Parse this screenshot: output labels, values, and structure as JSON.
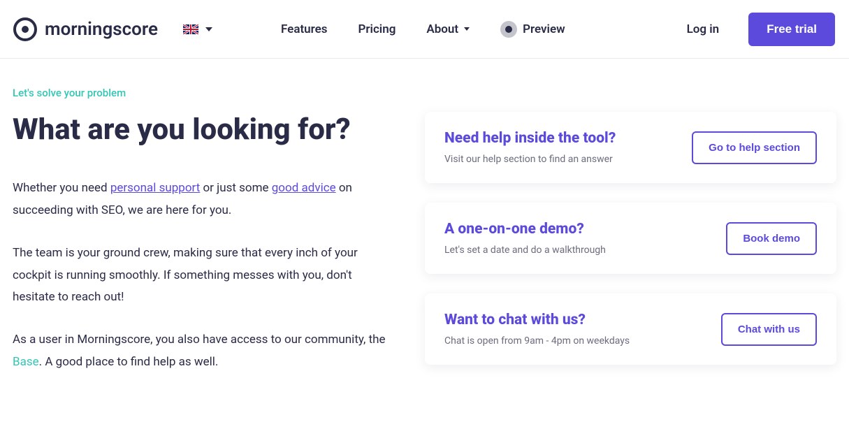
{
  "header": {
    "brand": "morningscore",
    "nav": {
      "features": "Features",
      "pricing": "Pricing",
      "about": "About",
      "preview": "Preview"
    },
    "login": "Log in",
    "cta": "Free trial"
  },
  "hero": {
    "eyebrow": "Let's solve your problem",
    "title": "What are you looking for?",
    "p1a": "Whether you need ",
    "p1_link1": "personal support",
    "p1b": " or just some ",
    "p1_link2": "good advice",
    "p1c": " on succeeding with SEO, we are here for you.",
    "p2": "The team is your ground crew, making sure that every inch of your cockpit is running smoothly. If something messes with you, don't hesitate to reach out!",
    "p3a": "As a user in Morningscore, you also have access to our community, the ",
    "p3_link": "Base",
    "p3b": ". A good place to find help as well."
  },
  "cards": [
    {
      "title": "Need help inside the tool?",
      "sub": "Visit our help section to find an answer",
      "btn": "Go to help section"
    },
    {
      "title": "A one-on-one demo?",
      "sub": "Let's set a date and do a walkthrough",
      "btn": "Book demo"
    },
    {
      "title": "Want to chat with us?",
      "sub": "Chat is open from 9am - 4pm on weekdays",
      "btn": "Chat with us"
    }
  ]
}
